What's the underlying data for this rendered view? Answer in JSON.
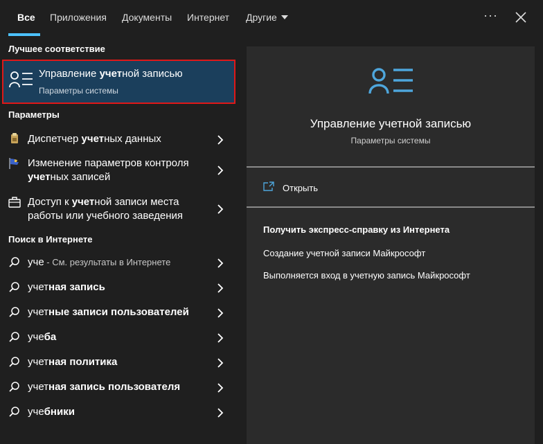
{
  "tabs": [
    "Все",
    "Приложения",
    "Документы",
    "Интернет",
    "Другие"
  ],
  "more_label": "···",
  "left": {
    "best_match_heading": "Лучшее соответствие",
    "best_match": {
      "title_pre": "Управление ",
      "title_bold": "учет",
      "title_post": "ной записью",
      "subtitle": "Параметры системы",
      "icon": "account-list-icon"
    },
    "settings_heading": "Параметры",
    "settings": [
      {
        "icon": "credential-manager-icon",
        "line1_pre": "Диспетчер ",
        "line1_bold": "учет",
        "line1_post": "ных данных"
      },
      {
        "icon": "uac-flag-icon",
        "line1": "Изменение параметров контроля",
        "line2_bold": "учет",
        "line2_post": "ных записей"
      },
      {
        "icon": "briefcase-icon",
        "line1_pre": "Доступ к ",
        "line1_bold": "учет",
        "line1_post": "ной записи места",
        "line2": "работы или учебного заведения"
      }
    ],
    "web_heading": "Поиск в Интернете",
    "web": [
      {
        "normal": "уче",
        "hint": " - См. результаты в Интернете"
      },
      {
        "normal": "учет",
        "bold": "ная запись"
      },
      {
        "normal": "учет",
        "bold": "ные записи пользователей"
      },
      {
        "normal": "уче",
        "bold": "ба"
      },
      {
        "normal": "учет",
        "bold": "ная политика"
      },
      {
        "normal": "учет",
        "bold": "ная запись пользователя"
      },
      {
        "normal": "уче",
        "bold": "бники"
      }
    ]
  },
  "right": {
    "title": "Управление учетной записью",
    "subtitle": "Параметры системы",
    "open_label": "Открыть",
    "help_heading": "Получить экспресс-справку из Интернета",
    "help_links": [
      "Создание учетной записи Майкрософт",
      "Выполняется вход в учетную запись Майкрософт"
    ]
  },
  "colors": {
    "accent": "#4cc2ff",
    "selection": "#1b3f5c",
    "highlight_border": "#e01818",
    "icon_blue": "#4ea6dc"
  }
}
